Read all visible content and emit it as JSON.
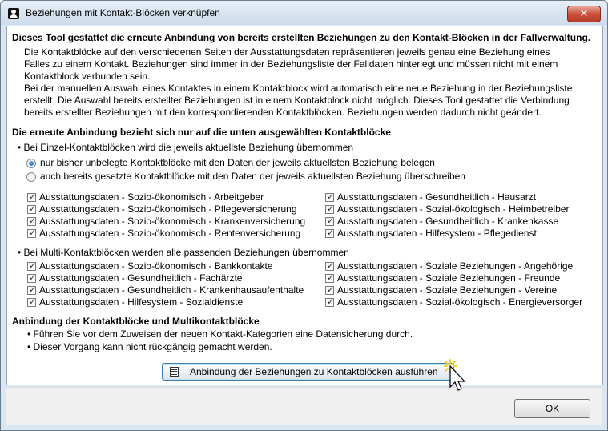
{
  "window": {
    "title": "Beziehungen mit Kontakt-Blöcken verknüpfen",
    "close_label": "✕"
  },
  "intro": {
    "heading": "Dieses Tool gestattet die erneute Anbindung von bereits erstellten Beziehungen zu den Kontakt-Blöcken in der Fallverwaltung.",
    "lines": [
      "Die Kontaktblöcke auf den verschiedenen Seiten der Ausstattungsdaten repräsentieren jeweils genau eine Beziehung eines",
      "Falles zu einem Kontakt. Beziehungen sind immer in der Beziehungsliste der Falldaten hinterlegt und müssen nicht mit einem",
      "Kontaktblock verbunden sein.",
      "Bei der manuellen Auswahl eines Kontaktes in einem Kontaktblock wird automatisch eine neue Beziehung in der Beziehungsliste",
      "erstellt. Die Auswahl bereits erstellter Beziehungen ist in einem Kontaktblock nicht möglich. Dieses Tool gestattet die Verbindung",
      "bereits erstellter Beziehungen mit den korrespondierenden Kontaktblöcken. Beziehungen werden dadurch nicht geändert."
    ]
  },
  "selection": {
    "heading": "Die erneute Anbindung bezieht sich nur auf die unten ausgewählten Kontaktblöcke",
    "single_note": "• Bei Einzel-Kontaktblöcken wird die jeweils aktuellste Beziehung übernommen",
    "radio_options": [
      {
        "label": "nur bisher unbelegte Kontaktblöcke mit den Daten der jeweils aktuellsten Beziehung belegen",
        "selected": true
      },
      {
        "label": "auch bereits gesetzte Kontaktblöcke mit den Daten der jeweils aktuellsten Beziehung überschreiben",
        "selected": false
      }
    ],
    "single_left": [
      "Ausstattungsdaten - Sozio-ökonomisch - Arbeitgeber",
      "Ausstattungsdaten - Sozio-ökonomisch - Pflegeversicherung",
      "Ausstattungsdaten - Sozio-ökonomisch - Krankenversicherung",
      "Ausstattungsdaten - Sozio-ökonomisch - Rentenversicherung"
    ],
    "single_right": [
      "Ausstattungsdaten - Gesundheitlich - Hausarzt",
      "Ausstattungsdaten - Sozial-ökologisch - Heimbetreiber",
      "Ausstattungsdaten - Gesundheitlich - Krankenkasse",
      "Ausstattungsdaten - Hilfesystem - Pflegedienst"
    ],
    "multi_note": "• Bei Multi-Kontaktblöcken werden alle passenden Beziehungen übernommen",
    "multi_left": [
      "Ausstattungsdaten - Sozio-ökonomisch - Bankkontakte",
      "Ausstattungsdaten - Gesundheitlich - Fachärzte",
      "Ausstattungsdaten - Gesundheitlich - Krankenhausaufenthalte",
      "Ausstattungsdaten - Hilfesystem - Sozialdienste"
    ],
    "multi_right": [
      "Ausstattungsdaten - Soziale Beziehungen - Angehörige",
      "Ausstattungsdaten - Soziale Beziehungen - Freunde",
      "Ausstattungsdaten - Soziale Beziehungen - Vereine",
      "Ausstattungsdaten - Sozial-ökologisch - Energieversorger"
    ],
    "checkbox_mark": "✓"
  },
  "notes": {
    "heading": "Anbindung der Kontaktblöcke und Multikontaktblöcke",
    "items": [
      "• Führen Sie vor dem Zuweisen der neuen Kontakt-Kategorien eine Datensicherung durch.",
      "• Dieser Vorgang kann nicht rückgängig gemacht werden."
    ]
  },
  "buttons": {
    "action": "Anbindung der Beziehungen zu Kontaktblöcken ausführen",
    "ok": "OK"
  }
}
